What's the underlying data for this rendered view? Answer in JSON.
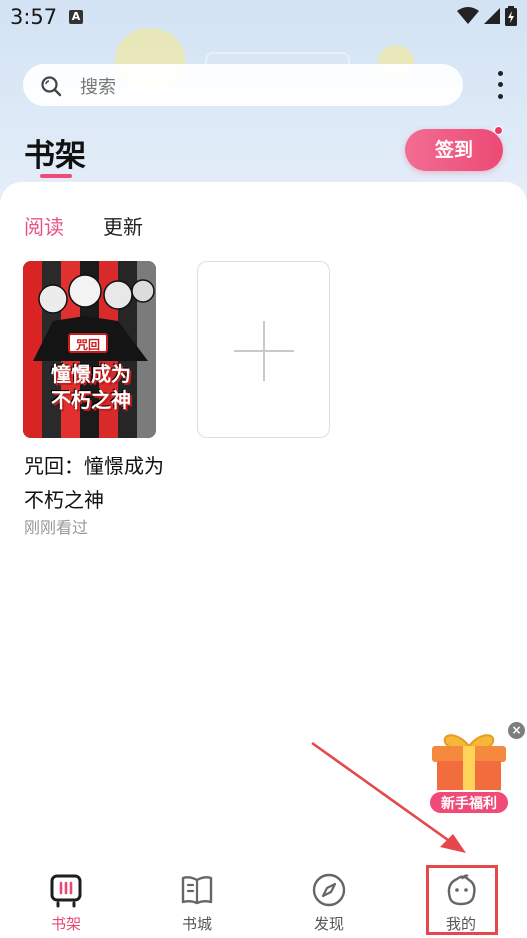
{
  "status_bar": {
    "time": "3:57",
    "notification_badge": "A"
  },
  "search": {
    "placeholder": "搜索"
  },
  "header": {
    "title": "书架",
    "signin_label": "签到"
  },
  "tabs": [
    {
      "label": "阅读",
      "active": true
    },
    {
      "label": "更新",
      "active": false
    }
  ],
  "books": [
    {
      "title": "咒回：憧憬成为不朽之神",
      "status": "刚刚看过",
      "cover_tag": "咒回",
      "cover_title_line1": "憧憬成为",
      "cover_title_line2": "不朽之神"
    }
  ],
  "gift": {
    "label": "新手福利",
    "close": "×"
  },
  "bottom_nav": [
    {
      "label": "书架",
      "icon": "bookshelf-icon",
      "active": true
    },
    {
      "label": "书城",
      "icon": "book-city-icon",
      "active": false
    },
    {
      "label": "发现",
      "icon": "compass-icon",
      "active": false
    },
    {
      "label": "我的",
      "icon": "profile-icon",
      "active": false
    }
  ],
  "colors": {
    "accent": "#e95480",
    "header_bg": "#d3e3f3",
    "annotation_red": "#e5474b"
  }
}
